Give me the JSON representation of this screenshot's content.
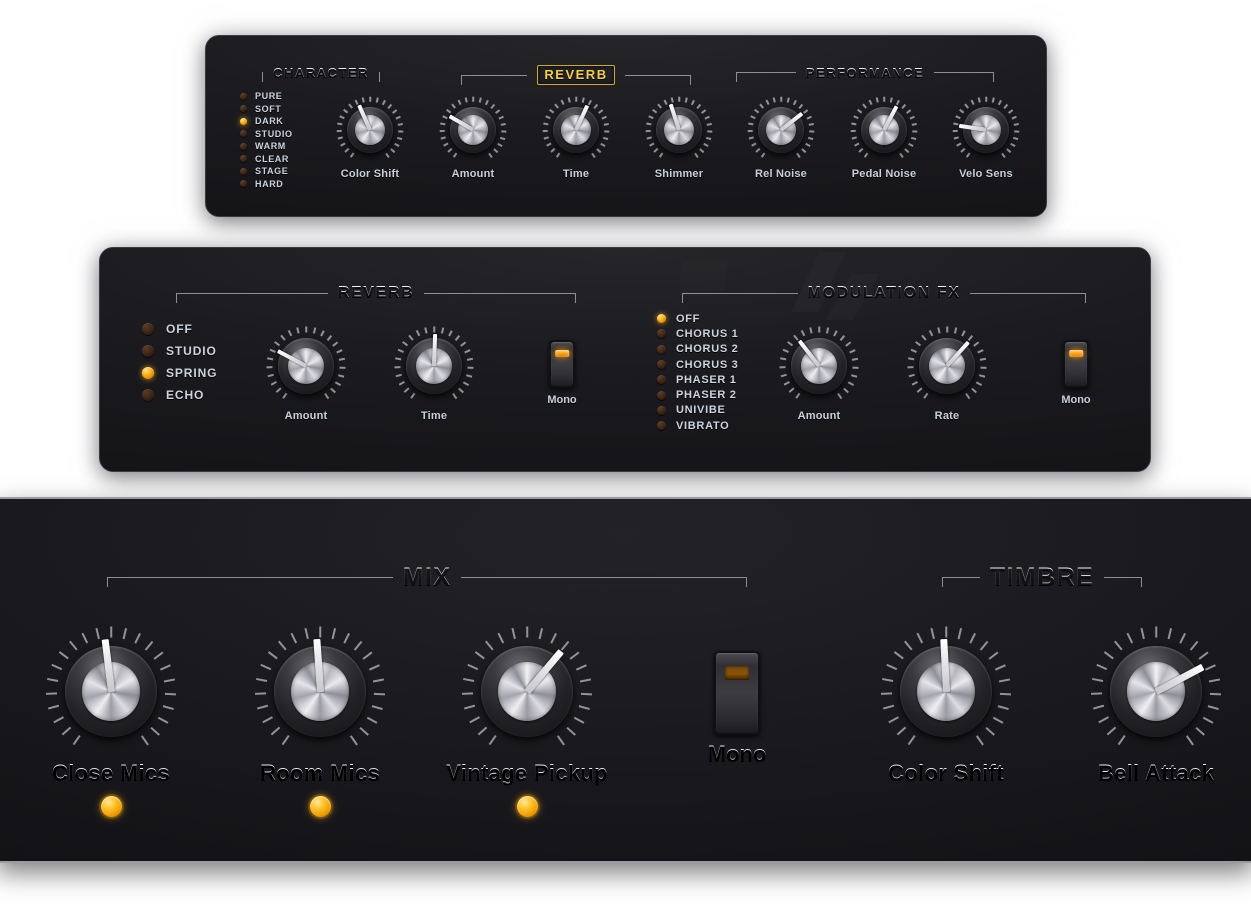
{
  "panels": {
    "character_panel": {
      "sections": {
        "character": {
          "title": "CHARACTER",
          "options": [
            {
              "label": "PURE",
              "on": false
            },
            {
              "label": "SOFT",
              "on": false
            },
            {
              "label": "DARK",
              "on": true
            },
            {
              "label": "STUDIO",
              "on": false
            },
            {
              "label": "WARM",
              "on": false
            },
            {
              "label": "CLEAR",
              "on": false
            },
            {
              "label": "STAGE",
              "on": false
            },
            {
              "label": "HARD",
              "on": false
            }
          ],
          "knobs": [
            {
              "label": "Color Shift",
              "angle": -24
            }
          ]
        },
        "reverb": {
          "title": "REVERB",
          "highlighted": true,
          "knobs": [
            {
              "label": "Amount",
              "angle": -60
            },
            {
              "label": "Time",
              "angle": 25
            },
            {
              "label": "Shimmer",
              "angle": -18
            }
          ]
        },
        "performance": {
          "title": "PERFORMANCE",
          "knobs": [
            {
              "label": "Rel Noise",
              "angle": 52
            },
            {
              "label": "Pedal Noise",
              "angle": 28
            },
            {
              "label": "Velo Sens",
              "angle": -82
            }
          ]
        }
      }
    },
    "effects_panel": {
      "sections": {
        "reverb": {
          "title": "REVERB",
          "options": [
            {
              "label": "OFF",
              "on": false
            },
            {
              "label": "STUDIO",
              "on": false
            },
            {
              "label": "SPRING",
              "on": true
            },
            {
              "label": "ECHO",
              "on": false
            }
          ],
          "knobs": [
            {
              "label": "Amount",
              "angle": -62
            },
            {
              "label": "Time",
              "angle": 2
            }
          ],
          "switch": {
            "label": "Mono",
            "on": true
          }
        },
        "modulation_fx": {
          "title": "MODULATION FX",
          "options": [
            {
              "label": "OFF",
              "on": true
            },
            {
              "label": "CHORUS 1",
              "on": false
            },
            {
              "label": "CHORUS 2",
              "on": false
            },
            {
              "label": "CHORUS 3",
              "on": false
            },
            {
              "label": "PHASER 1",
              "on": false
            },
            {
              "label": "PHASER 2",
              "on": false
            },
            {
              "label": "UNIVIBE",
              "on": false
            },
            {
              "label": "VIBRATO",
              "on": false
            }
          ],
          "knobs": [
            {
              "label": "Amount",
              "angle": -38
            },
            {
              "label": "Rate",
              "angle": 42
            }
          ],
          "switch": {
            "label": "Mono",
            "on": true
          }
        }
      }
    },
    "mix_panel": {
      "sections": {
        "mix": {
          "title": "MIX",
          "knobs": [
            {
              "label": "Close Mics",
              "angle": -7,
              "status_led": true
            },
            {
              "label": "Room Mics",
              "angle": -4,
              "status_led": true
            },
            {
              "label": "Vintage Pickup",
              "angle": 40,
              "status_led": true
            }
          ],
          "switch": {
            "label": "Mono",
            "on": false
          }
        },
        "timbre": {
          "title": "TIMBRE",
          "knobs": [
            {
              "label": "Color Shift",
              "angle": -3
            },
            {
              "label": "Bell Attack",
              "angle": 62
            }
          ]
        }
      }
    }
  },
  "colors": {
    "led_on": "#ffb419",
    "led_off": "#3a2414",
    "panel_bg": "#1b1b1f",
    "label_text": "#cdd3df",
    "accent_yellow": "#f2cd4e",
    "rule": "#8e8e96"
  }
}
